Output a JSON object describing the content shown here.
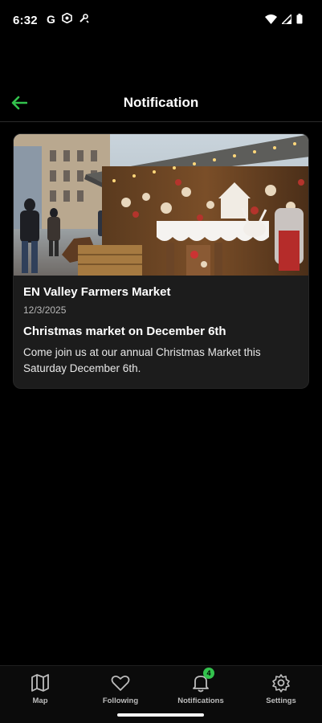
{
  "status": {
    "time": "6:32",
    "left_icons": [
      "google-g-icon",
      "settings-badge-icon",
      "tools-icon"
    ],
    "right_icons": [
      "wifi-icon",
      "signal-icon",
      "battery-icon"
    ]
  },
  "header": {
    "title": "Notification",
    "back_icon": "back-arrow-icon",
    "accent_color": "#33c24d"
  },
  "notification": {
    "market_name": "EN Valley Farmers Market",
    "date": "12/3/2025",
    "title": "Christmas market on December 6th",
    "body": "Come join us at our annual Christmas Market this Saturday December 6th.",
    "image": "christmas-market-stall-photo"
  },
  "bottom_nav": {
    "items": [
      {
        "label": "Map",
        "icon": "map-icon"
      },
      {
        "label": "Following",
        "icon": "heart-icon"
      },
      {
        "label": "Notifications",
        "icon": "bell-icon",
        "badge": "4"
      },
      {
        "label": "Settings",
        "icon": "gear-icon"
      }
    ]
  }
}
